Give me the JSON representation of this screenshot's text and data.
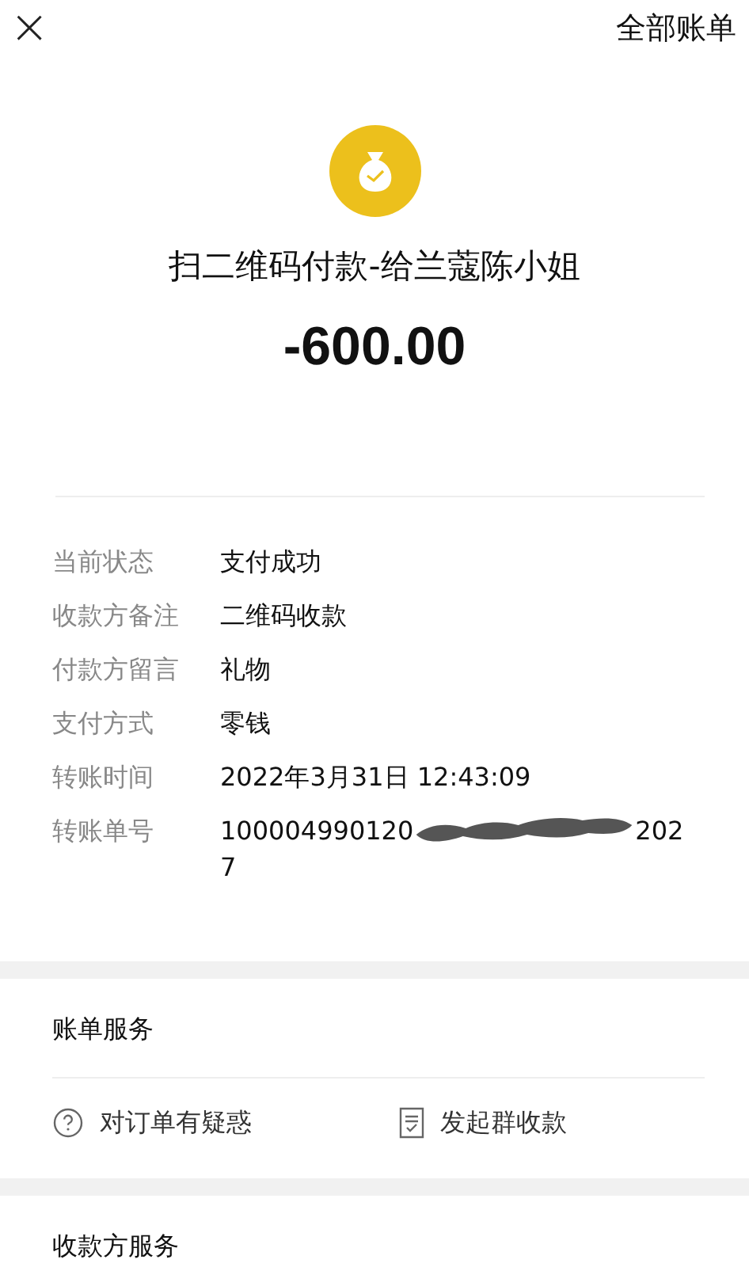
{
  "top_bar": {
    "close": "×",
    "all_bills": "全部账单"
  },
  "summary": {
    "title": "扫二维码付款-给兰蔻陈小姐",
    "amount": "-600.00"
  },
  "details": [
    {
      "kind": "plain",
      "label": "当前状态",
      "value": "支付成功"
    },
    {
      "kind": "plain",
      "label": "收款方备注",
      "value": "二维码收款"
    },
    {
      "kind": "plain",
      "label": "付款方留言",
      "value": "礼物"
    },
    {
      "kind": "plain",
      "label": "支付方式",
      "value": "零钱"
    },
    {
      "kind": "plain",
      "label": "转账时间",
      "value": "2022年3月31日 12:43:09"
    },
    {
      "kind": "redacted",
      "label": "转账单号",
      "value": "100004990120",
      "value_after": "202",
      "value_last_line": "7"
    }
  ],
  "bill_service": {
    "title": "账单服务",
    "actions": [
      {
        "kind": "question",
        "label": "对订单有疑惑"
      },
      {
        "kind": "receipt",
        "label": "发起群收款"
      }
    ]
  },
  "payee_service": {
    "title": "收款方服务"
  }
}
